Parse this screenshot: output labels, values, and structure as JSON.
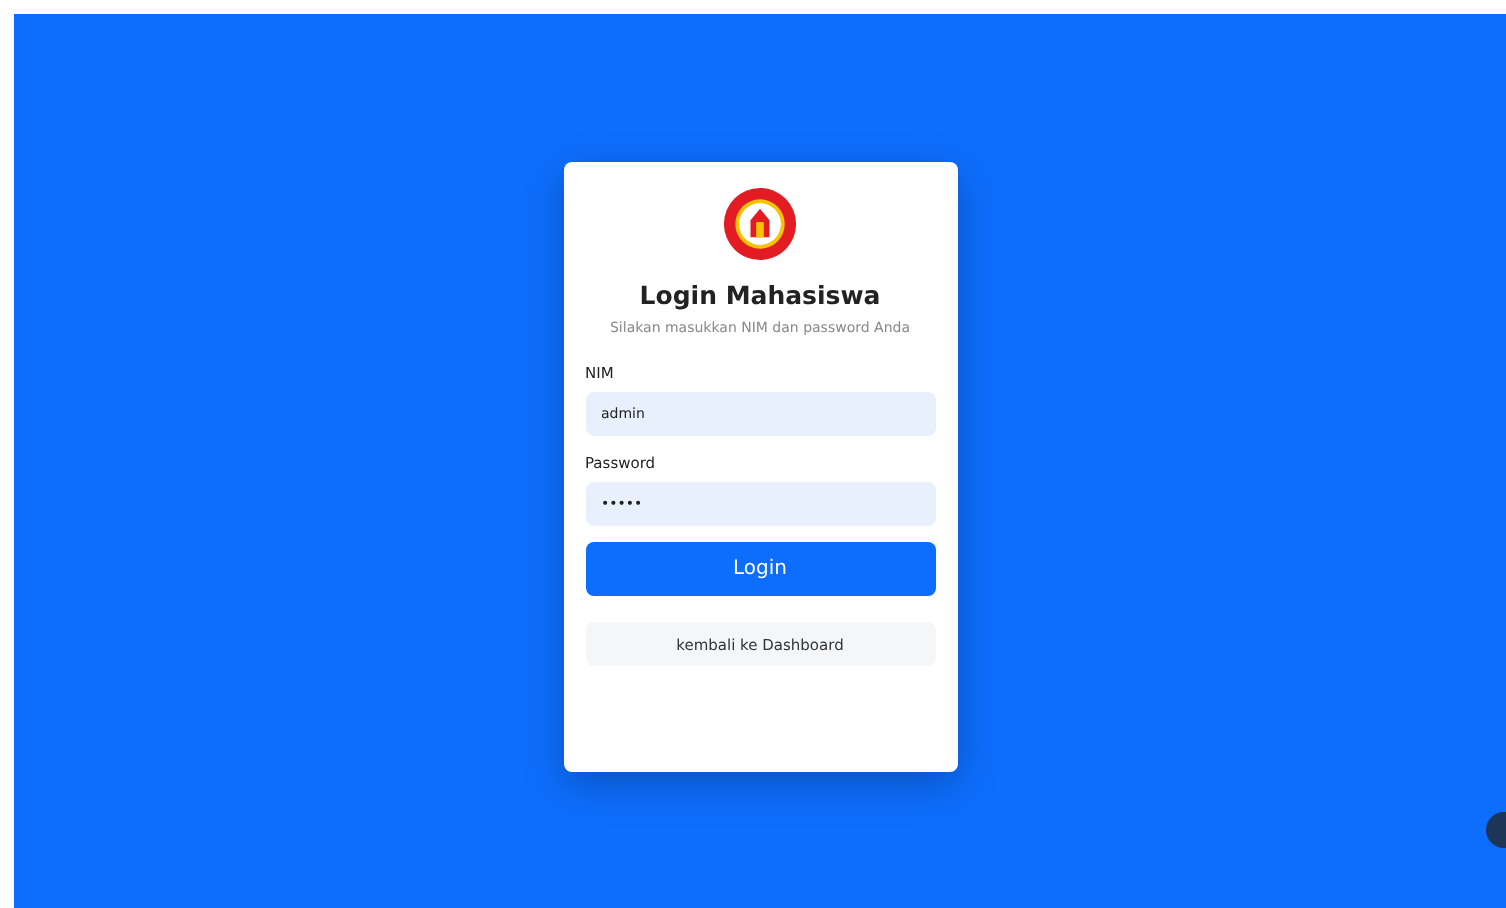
{
  "card": {
    "title": "Login Mahasiswa",
    "subtitle": "Silakan masukkan NIM dan password Anda",
    "fields": [
      {
        "label": "NIM",
        "value": "admin"
      },
      {
        "label": "Password",
        "value": "•••••"
      }
    ],
    "login_button": "Login",
    "back_button": "kembali ke Dashboard"
  }
}
